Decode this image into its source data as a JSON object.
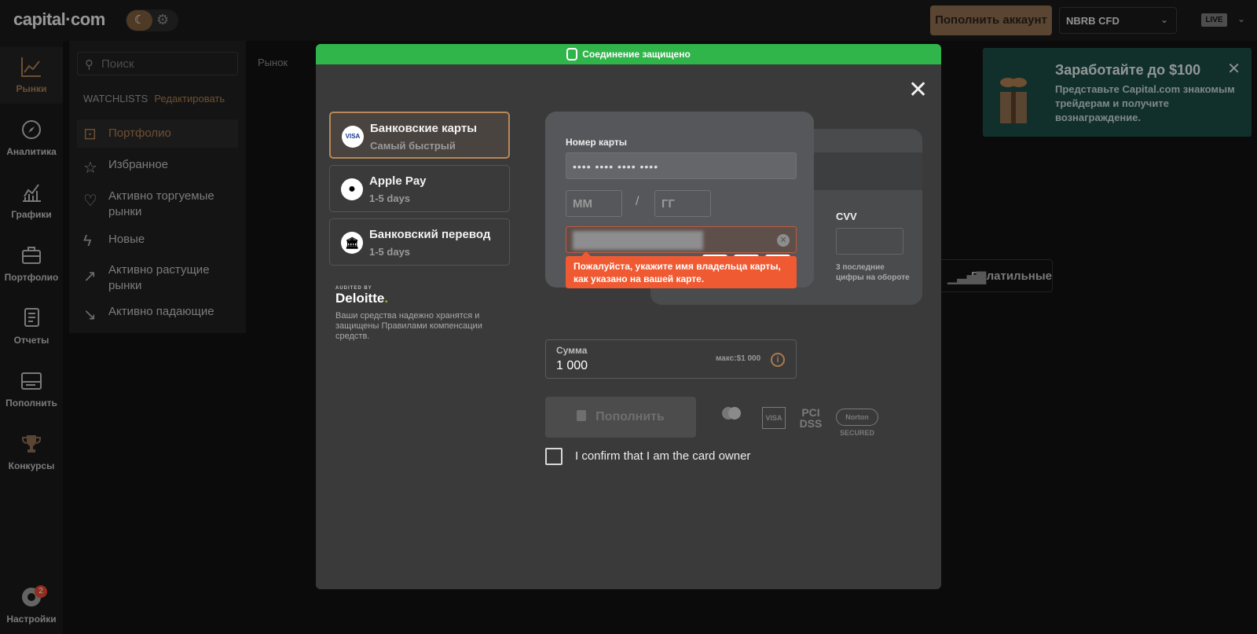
{
  "app": {
    "logo": "capital·com",
    "topup_label": "Пополнить аккаунт",
    "account": "NBRB CFD",
    "mode": "LIVE"
  },
  "nav": {
    "items": [
      {
        "label": "Рынки",
        "icon": "chart-up-icon"
      },
      {
        "label": "Аналитика",
        "icon": "compass-icon"
      },
      {
        "label": "Графики",
        "icon": "line-chart-icon"
      },
      {
        "label": "Портфолио",
        "icon": "briefcase-icon"
      },
      {
        "label": "Отчеты",
        "icon": "document-icon"
      },
      {
        "label": "Пополнить",
        "icon": "card-icon"
      },
      {
        "label": "Конкурсы",
        "icon": "trophy-icon"
      },
      {
        "label": "Настройки",
        "icon": "gear-icon",
        "badge": "2"
      }
    ]
  },
  "markets_panel": {
    "search_placeholder": "Поиск",
    "tab": "Рынок",
    "watchlists_label": "WATCHLISTS",
    "edit_label": "Редактировать",
    "lists": [
      {
        "label": "Портфолио"
      },
      {
        "label": "Избранное"
      },
      {
        "label": "Активно торгуемые рынки"
      },
      {
        "label": "Новые"
      },
      {
        "label": "Активно растущие рынки"
      },
      {
        "label": "Активно падающие"
      }
    ],
    "volatile_label": "Волатильные"
  },
  "promo": {
    "title": "Заработайте до $100",
    "body": "Представьте Capital.com знакомым трейдерам и получите вознаграждение."
  },
  "modal": {
    "secure_label": "Соединение защищено",
    "methods": [
      {
        "title": "Банковские карты",
        "subtitle": "Самый быстрый",
        "icon": "VISA"
      },
      {
        "title": "Apple Pay",
        "subtitle": "1-5 days",
        "icon": ""
      },
      {
        "title": "Банковский перевод",
        "subtitle": "1-5 days",
        "icon": "🏛"
      }
    ],
    "audited_by": "AUDITED BY",
    "deloitte": "Deloitte",
    "funds_note": "Ваши средства надежно хранятся и защищены Правилами компенсации средств.",
    "card": {
      "number_label": "Номер карты",
      "number_placeholder": "•••• •••• •••• ••••",
      "mm_placeholder": "ММ",
      "slash": "/",
      "yy_placeholder": "ГГ",
      "cvv_label": "CVV",
      "cvv_hint": "3 последние цифры на обороте"
    },
    "error_text": "Пожалуйста, укажите имя владельца карты, как указано на вашей карте.",
    "amount": {
      "label": "Сумма",
      "value": "1 000",
      "max": "макс:$1 000"
    },
    "deposit_label": "Пополнить",
    "trust_logos": [
      "mastercard",
      "VISA",
      "PCI DSS",
      "Norton SECURED"
    ],
    "confirm_label": "I confirm that I am the card owner"
  },
  "colors": {
    "accent": "#a97a4e",
    "secure_green": "#2fb54a",
    "error": "#f05a32"
  }
}
